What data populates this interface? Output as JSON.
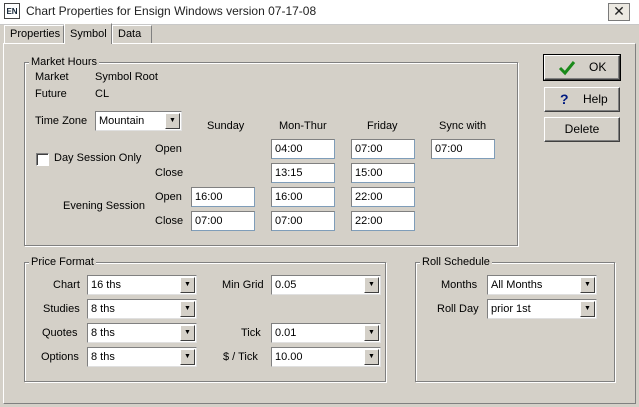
{
  "window": {
    "title": "Chart Properties for Ensign Windows version 07-17-08",
    "icon_text": "EN",
    "close_glyph": "✕"
  },
  "tabs": [
    {
      "label": "Properties"
    },
    {
      "label": "Symbol"
    },
    {
      "label": "Data"
    }
  ],
  "market_hours": {
    "group_label": "Market Hours",
    "market_label": "Market",
    "market_value": "Symbol Root",
    "future_label": "Future",
    "future_value": "CL",
    "time_zone_label": "Time Zone",
    "time_zone_value": "Mountain",
    "day_session_label": "Day Session Only",
    "day_session_checked": false,
    "col_sunday": "Sunday",
    "col_monthur": "Mon-Thur",
    "col_friday": "Friday",
    "col_sync": "Sync with",
    "open_label": "Open",
    "close_label": "Close",
    "evening_label": "Evening Session",
    "eve_open_label": "Open",
    "eve_close_label": "Close",
    "day_open_monthur": "04:00",
    "day_open_friday": "07:00",
    "sync_with_value": "07:00",
    "day_close_monthur": "13:15",
    "day_close_friday": "15:00",
    "eve_open_sunday": "16:00",
    "eve_open_monthur": "16:00",
    "eve_open_friday": "22:00",
    "eve_close_sunday": "07:00",
    "eve_close_monthur": "07:00",
    "eve_close_friday": "22:00"
  },
  "price_format": {
    "group_label": "Price Format",
    "chart_label": "Chart",
    "chart_value": "16 ths",
    "studies_label": "Studies",
    "studies_value": "8 ths",
    "quotes_label": "Quotes",
    "quotes_value": "8 ths",
    "options_label": "Options",
    "options_value": "8 ths",
    "min_grid_label": "Min Grid",
    "min_grid_value": "0.05",
    "tick_label": "Tick",
    "tick_value": "0.01",
    "dollar_tick_label": "$ / Tick",
    "dollar_tick_value": "10.00"
  },
  "roll_schedule": {
    "group_label": "Roll Schedule",
    "months_label": "Months",
    "months_value": "All Months",
    "roll_day_label": "Roll Day",
    "roll_day_value": "prior 1st"
  },
  "buttons": {
    "ok_label": "OK",
    "help_label": "Help",
    "delete_label": "Delete"
  },
  "icons": {
    "ok": "checkmark-icon",
    "help": "question-icon",
    "dropdown": "chevron-down-icon"
  },
  "colors": {
    "ok_check": "#1a8a1a",
    "help_q": "#001a80"
  }
}
